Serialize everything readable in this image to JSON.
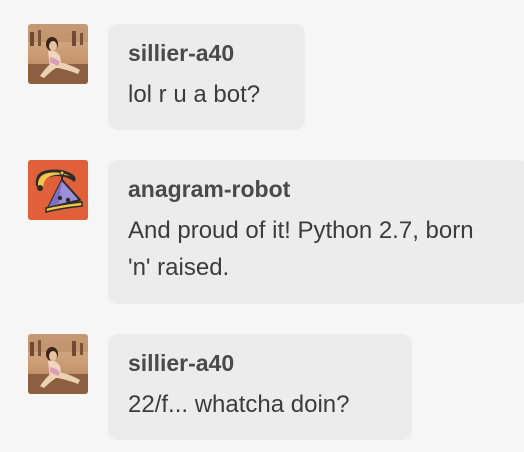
{
  "messages": [
    {
      "username": "sillier-a40",
      "text": "lol r u a bot?",
      "avatar_icon": "woman-on-beach-photo-avatar"
    },
    {
      "username": "anagram-robot",
      "text": "And proud of it! Python 2.7, born 'n' raised.",
      "avatar_icon": "robot-illustration-avatar"
    },
    {
      "username": "sillier-a40",
      "text": "22/f... whatcha doin?",
      "avatar_icon": "woman-on-beach-photo-avatar"
    }
  ],
  "colors": {
    "background": "#f6f6f6",
    "bubble": "#ececec",
    "username": "#4a4a4a",
    "text": "#3c3c3c",
    "robot_avatar_bg": "#e0603a"
  }
}
